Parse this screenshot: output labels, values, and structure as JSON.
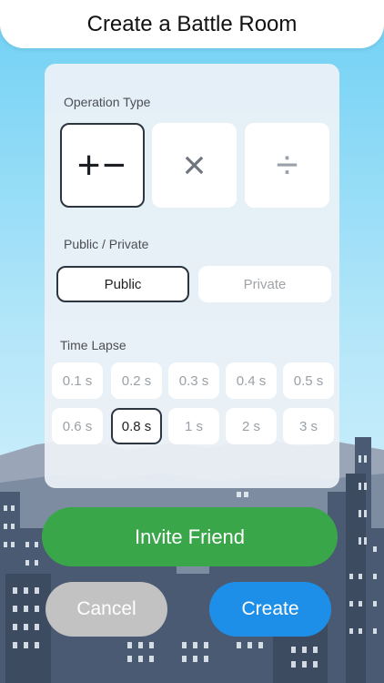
{
  "header": {
    "title": "Create a Battle Room"
  },
  "operation": {
    "label": "Operation Type",
    "options": [
      {
        "symbol": "+−",
        "name": "addition-subtraction"
      },
      {
        "symbol": "×",
        "name": "multiplication"
      },
      {
        "symbol": "÷",
        "name": "division"
      }
    ],
    "selected_index": 0
  },
  "visibility": {
    "label": "Public / Private",
    "options": [
      "Public",
      "Private"
    ],
    "selected": "Public"
  },
  "time_lapse": {
    "label": "Time Lapse",
    "options": [
      "0.1 s",
      "0.2 s",
      "0.3 s",
      "0.4 s",
      "0.5 s",
      "0.6 s",
      "0.8 s",
      "1 s",
      "2 s",
      "3 s"
    ],
    "selected": "0.8 s"
  },
  "buttons": {
    "invite": "Invite Friend",
    "cancel": "Cancel",
    "create": "Create"
  },
  "colors": {
    "invite": "#3aa64a",
    "create": "#1e8fe8",
    "cancel": "#c2c2c2",
    "selected_border": "#2c3540"
  }
}
